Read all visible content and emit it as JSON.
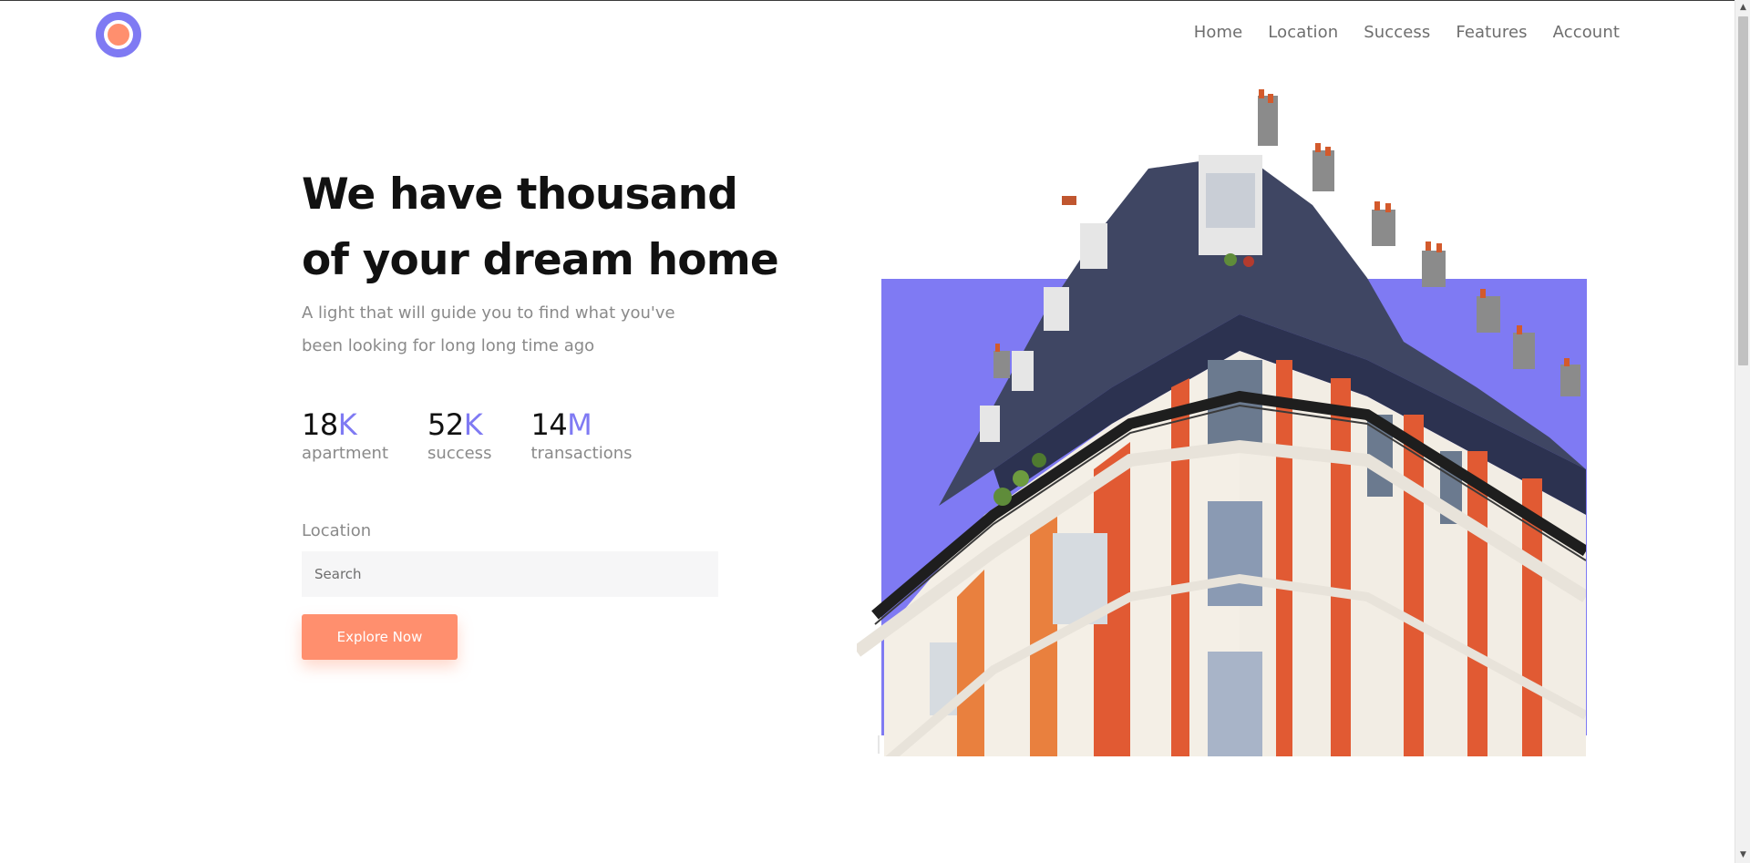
{
  "brand": {
    "accent": "#7f7af3",
    "accent2": "#ff8f6e"
  },
  "nav": {
    "items": [
      "Home",
      "Location",
      "Success",
      "Features",
      "Account"
    ]
  },
  "hero": {
    "title_line1": "We have thousand",
    "title_line2": "of your dream home",
    "subtitle_line1": "A light that will guide you to find what you've",
    "subtitle_line2": "been looking for long long time ago"
  },
  "stats": [
    {
      "number": "18",
      "unit": "K",
      "label": "apartment"
    },
    {
      "number": "52",
      "unit": "K",
      "label": "success"
    },
    {
      "number": "14",
      "unit": "M",
      "label": "transactions"
    }
  ],
  "search": {
    "label": "Location",
    "placeholder": "Search"
  },
  "cta": {
    "label": "Explore Now"
  },
  "icons": {
    "logo": "circle-logo-icon",
    "image": "apartment-building-photo"
  }
}
